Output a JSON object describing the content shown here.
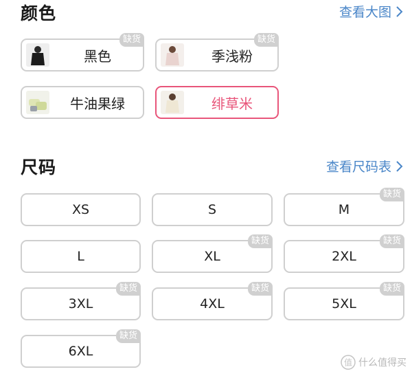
{
  "color": {
    "title": "颜色",
    "view_large": "查看大图",
    "options": [
      {
        "label": "黑色",
        "tag": "缺货"
      },
      {
        "label": "季浅粉",
        "tag": "缺货"
      },
      {
        "label": "牛油果绿"
      },
      {
        "label": "绯草米",
        "selected": true
      }
    ]
  },
  "size": {
    "title": "尺码",
    "view_chart": "查看尺码表",
    "options": [
      {
        "label": "XS"
      },
      {
        "label": "S"
      },
      {
        "label": "M",
        "tag": "缺货"
      },
      {
        "label": "L"
      },
      {
        "label": "XL",
        "tag": "缺货"
      },
      {
        "label": "2XL",
        "tag": "缺货"
      },
      {
        "label": "3XL",
        "tag": "缺货"
      },
      {
        "label": "4XL",
        "tag": "缺货"
      },
      {
        "label": "5XL",
        "tag": "缺货"
      },
      {
        "label": "6XL",
        "tag": "缺货"
      }
    ]
  },
  "watermark": "什么值得买",
  "colors": {
    "accent": "#e8557a",
    "link": "#4a86c8",
    "border": "#cfcfcf",
    "tag_bg": "#d0d0d0"
  }
}
